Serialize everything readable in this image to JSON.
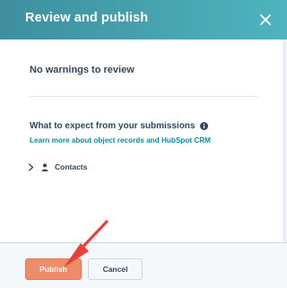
{
  "dialog": {
    "title": "Review and publish",
    "close_icon": "close-icon"
  },
  "review": {
    "warnings_text": "No warnings to review"
  },
  "expectations": {
    "title": "What to expect from your submissions",
    "info_icon": "info-icon",
    "learn_link": "Learn more about object records and HubSpot CRM",
    "items": [
      {
        "label": "Contacts",
        "icon": "contact-person-icon",
        "expand_icon": "chevron-right-icon"
      }
    ]
  },
  "footer": {
    "publish_label": "Publish",
    "cancel_label": "Cancel"
  },
  "annotation": {
    "arrow_color": "#e8413a"
  },
  "colors": {
    "header_start": "#3d8f9e",
    "header_end": "#4fb4bd",
    "primary_button": "#ee8c6a",
    "link": "#0091ae"
  }
}
